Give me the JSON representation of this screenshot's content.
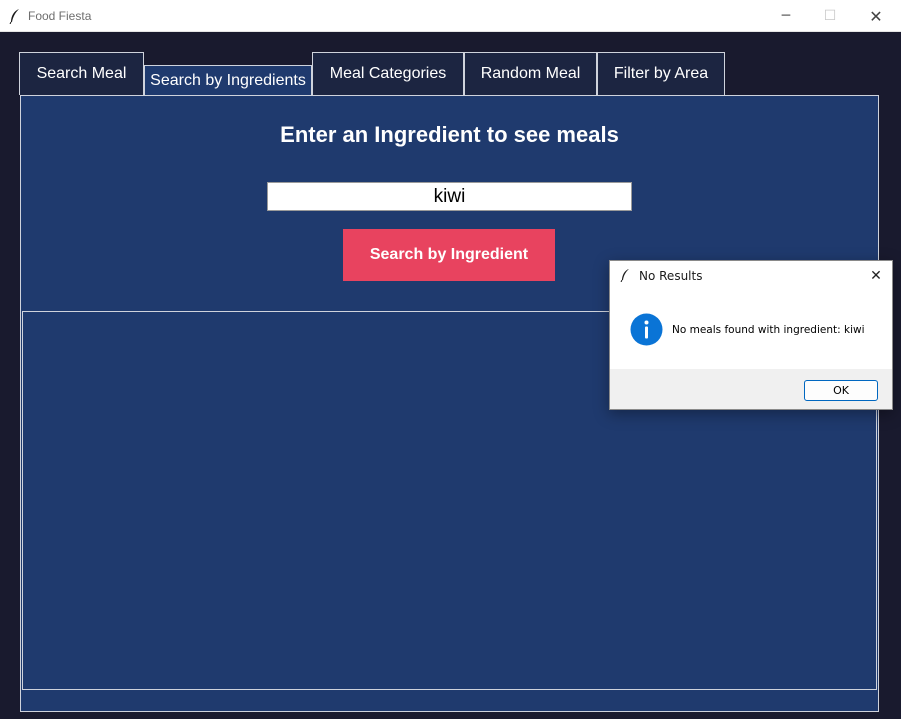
{
  "window": {
    "title": "Food Fiesta",
    "minimize_glyph": "─",
    "maximize_glyph": "☐",
    "close_glyph": "✕"
  },
  "tabs": [
    {
      "label": "Search Meal",
      "active": false
    },
    {
      "label": "Search by Ingredients",
      "active": true
    },
    {
      "label": "Meal Categories",
      "active": false
    },
    {
      "label": "Random Meal",
      "active": false
    },
    {
      "label": "Filter by Area",
      "active": false
    }
  ],
  "main": {
    "heading": "Enter an Ingredient to see meals",
    "ingredient_value": "kiwi",
    "search_button": "Search by Ingredient"
  },
  "dialog": {
    "title": "No Results",
    "message": "No meals found with ingredient: kiwi",
    "ok_label": "OK",
    "close_glyph": "✕"
  },
  "icons": {
    "app_icon": "feather-icon",
    "info_icon": "info-icon"
  },
  "colors": {
    "background": "#191a2e",
    "panel": "#1f3a6e",
    "tab": "#1c2541",
    "button": "#e8435f",
    "info": "#0a74d6"
  }
}
